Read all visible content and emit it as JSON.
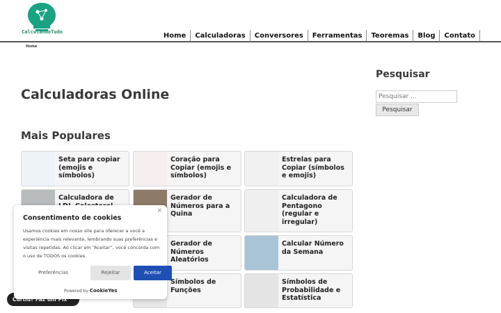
{
  "header": {
    "logo_text": "CalculandoTudo",
    "nav": [
      "Home",
      "Calculadoras",
      "Conversores",
      "Ferramentas",
      "Teoremas",
      "Blog",
      "Contato"
    ]
  },
  "breadcrumb": "Home",
  "main": {
    "title": "Calculadoras Online",
    "section_title": "Mais Populares",
    "cards": [
      {
        "label": "Seta para copiar (emojis e símbolos)",
        "color": "#eef3f8"
      },
      {
        "label": "Coração para Copiar (emojis e símbolos)",
        "color": "#f7efef"
      },
      {
        "label": "Estrelas para Copiar (símbolos e emojis)",
        "color": "#f1f1f1"
      },
      {
        "label": "Calculadora de LDL-Colesterol",
        "color": "#b8bcbd"
      },
      {
        "label": "Gerador de Números para a Quina",
        "color": "#8e7a68"
      },
      {
        "label": "Calculadora de Pentagono (regular e irregular)",
        "color": "#efefef"
      },
      {
        "label": "Gerador de Números Aleatórios",
        "color": "#e2e2e2"
      },
      {
        "label": "Calcular Número da Semana",
        "color": "#a9c4d6"
      },
      {
        "label": "Símbolos de Funções",
        "color": "#e6e6e6"
      },
      {
        "label": "Símbolos de Probabilidade e Estatística",
        "color": "#e4e4e4"
      }
    ]
  },
  "sidebar": {
    "title": "Pesquisar",
    "search_placeholder": "Pesquisar ...",
    "search_button": "Pesquisar"
  },
  "consent": {
    "close": "×",
    "title": "Consentimento de cookies",
    "text": "Usamos cookies em nosso site para oferecer a você a experiência mais relevante, lembrando suas preferências e visitas repetidas. Ao clicar em “Aceitar”, você concorda com o uso de TODOS os cookies.",
    "preferences": "Preferências",
    "reject": "Rejeitar",
    "accept": "Aceitar",
    "powered_by": "Powered by",
    "brand": "CookieYes"
  },
  "pix_badge": "Curtiu? Faz um Pix"
}
